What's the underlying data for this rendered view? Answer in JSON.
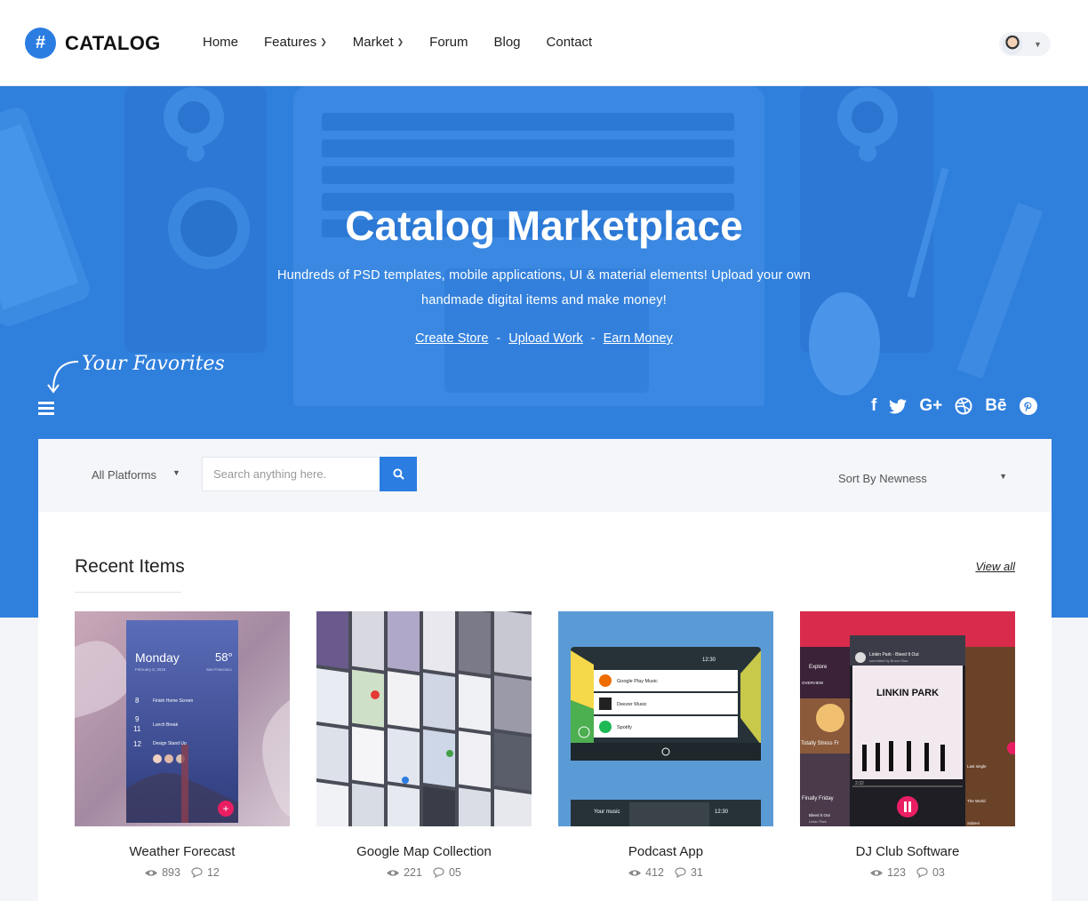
{
  "logo": {
    "mark": "#",
    "text": "CATALOG"
  },
  "nav": {
    "home": "Home",
    "features": "Features",
    "market": "Market",
    "forum": "Forum",
    "blog": "Blog",
    "contact": "Contact"
  },
  "hero": {
    "title": "Catalog Marketplace",
    "subtitle": "Hundreds of PSD templates, mobile applications, UI & material elements! Upload your own handmade digital items and make money!",
    "links": {
      "create": "Create Store",
      "upload": "Upload Work",
      "earn": "Earn Money",
      "separator": "-"
    },
    "favorites": "Your Favorites",
    "social_icons": [
      "facebook-icon",
      "twitter-icon",
      "google-plus-icon",
      "dribbble-icon",
      "behance-icon",
      "pinterest-icon"
    ],
    "social_glyphs": {
      "facebook": "f",
      "google": "G+",
      "behance": "Bē"
    }
  },
  "filters": {
    "platform": "All Platforms",
    "search_placeholder": "Search anything here.",
    "sort": "Sort By Newness"
  },
  "recent": {
    "title": "Recent Items",
    "view_all": "View all",
    "items": [
      {
        "title": "Weather Forecast",
        "views": "893",
        "comments": "12"
      },
      {
        "title": "Google Map Collection",
        "views": "221",
        "comments": "05"
      },
      {
        "title": "Podcast App",
        "views": "412",
        "comments": "31"
      },
      {
        "title": "DJ Club Software",
        "views": "123",
        "comments": "03"
      }
    ]
  },
  "thumbs": {
    "weather": {
      "day": "Monday",
      "date": "February 8, 2015",
      "temp": "58°",
      "place": "San Francisco",
      "rows": [
        "Finish Home Screen",
        "Lunch Break",
        "Design Stand Up"
      ],
      "times": [
        "8",
        "9",
        "11",
        "12"
      ]
    },
    "podcast": {
      "clock": "12:30",
      "apps": [
        "Google Play Music",
        "Deezer Music",
        "Spotify"
      ],
      "lower": "Your music"
    },
    "dj": {
      "header": "Linkin Park - Bleed It Out",
      "sub": "submitted by Bruce Diaz",
      "explore": "Explore",
      "band": "LINKIN PARK",
      "overview": "OVERVIEW",
      "stress": "Totally Stress Fr",
      "friday": "Finally Friday",
      "bleed": "Bleed It Out",
      "bleed_sub": "Linkin Park",
      "side": [
        "Last single",
        "The World",
        "Sabeni"
      ],
      "time": "2:32"
    }
  },
  "colors": {
    "brand": "#2b7de1",
    "hero": "#2f7fdc",
    "accent_pink": "#e91e63"
  }
}
